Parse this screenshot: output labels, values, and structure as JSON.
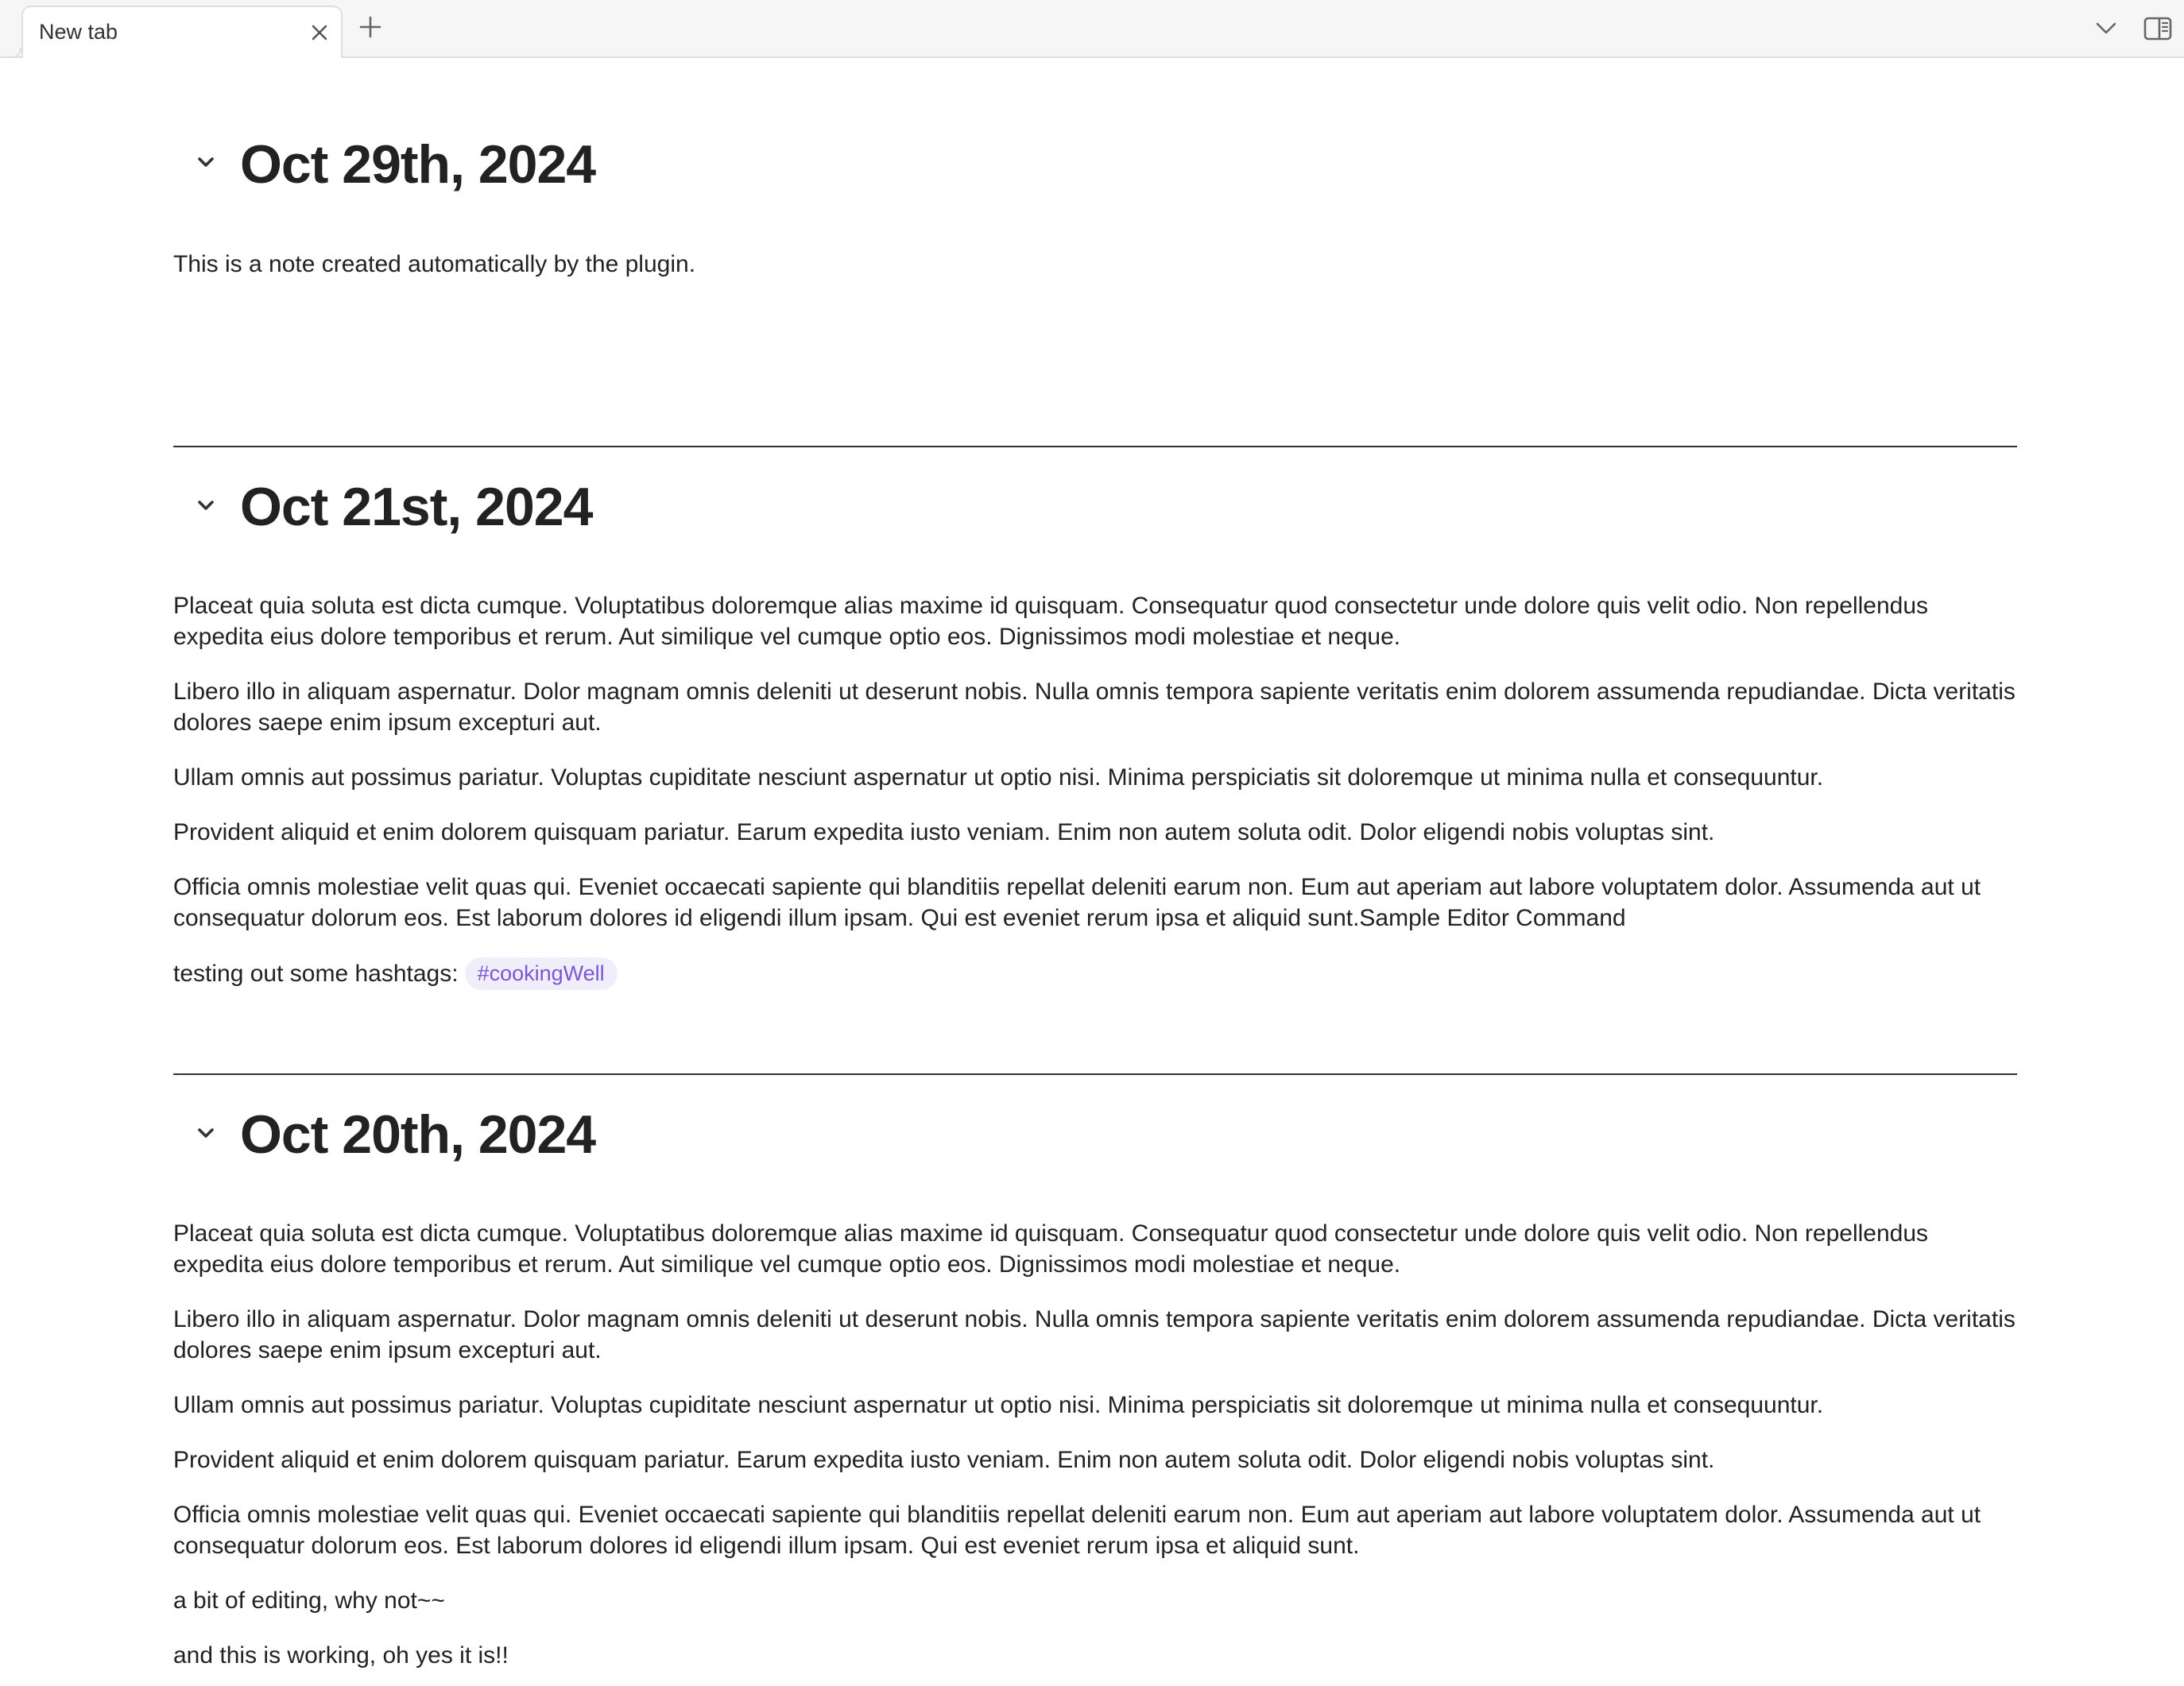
{
  "tabs": {
    "active_tab_title": "New tab",
    "close_icon": "close-icon",
    "new_tab_icon": "plus-icon",
    "tab_list_icon": "chevron-down-icon",
    "sidebar_icon": "sidebar-toggle-icon"
  },
  "colors": {
    "accent": "#7a55d6",
    "tag_background": "#f1eefc",
    "text": "#222222",
    "divider": "#333333"
  },
  "notes": [
    {
      "title": "Oct 29th, 2024",
      "paragraphs": [
        "This is a note created automatically by the plugin."
      ]
    },
    {
      "title": "Oct 21st, 2024",
      "paragraphs": [
        "Placeat quia soluta est dicta cumque. Voluptatibus doloremque alias maxime id quisquam. Consequatur quod consectetur unde dolore quis velit odio. Non repellendus expedita eius dolore temporibus et rerum. Aut similique vel cumque optio eos. Dignissimos modi molestiae et neque.",
        "Libero illo in aliquam aspernatur. Dolor magnam omnis deleniti ut deserunt nobis. Nulla omnis tempora sapiente veritatis enim dolorem assumenda repudiandae. Dicta veritatis dolores saepe enim ipsum excepturi aut.",
        "Ullam omnis aut possimus pariatur. Voluptas cupiditate nesciunt aspernatur ut optio nisi. Minima perspiciatis sit doloremque ut minima nulla et consequuntur.",
        "Provident aliquid et enim dolorem quisquam pariatur. Earum expedita iusto veniam. Enim non autem soluta odit. Dolor eligendi nobis voluptas sint.",
        "Officia omnis molestiae velit quas qui. Eveniet occaecati sapiente qui blanditiis repellat deleniti earum non. Eum aut aperiam aut labore voluptatem dolor. Assumenda aut ut consequatur dolorum eos. Est laborum dolores id eligendi illum ipsam. Qui est eveniet rerum ipsa et aliquid sunt.Sample Editor Command"
      ],
      "hashtag_line": "testing out some hashtags:",
      "hashtag": "#cookingWell"
    },
    {
      "title": "Oct 20th, 2024",
      "paragraphs": [
        "Placeat quia soluta est dicta cumque. Voluptatibus doloremque alias maxime id quisquam. Consequatur quod consectetur unde dolore quis velit odio. Non repellendus expedita eius dolore temporibus et rerum. Aut similique vel cumque optio eos. Dignissimos modi molestiae et neque.",
        "Libero illo in aliquam aspernatur. Dolor magnam omnis deleniti ut deserunt nobis. Nulla omnis tempora sapiente veritatis enim dolorem assumenda repudiandae. Dicta veritatis dolores saepe enim ipsum excepturi aut.",
        "Ullam omnis aut possimus pariatur. Voluptas cupiditate nesciunt aspernatur ut optio nisi. Minima perspiciatis sit doloremque ut minima nulla et consequuntur.",
        "Provident aliquid et enim dolorem quisquam pariatur. Earum expedita iusto veniam. Enim non autem soluta odit. Dolor eligendi nobis voluptas sint.",
        "Officia omnis molestiae velit quas qui. Eveniet occaecati sapiente qui blanditiis repellat deleniti earum non. Eum aut aperiam aut labore voluptatem dolor. Assumenda aut ut consequatur dolorum eos. Est laborum dolores id eligendi illum ipsam. Qui est eveniet rerum ipsa et aliquid sunt.",
        "a bit of editing, why not~~",
        "and this is working, oh yes it is!!"
      ]
    }
  ]
}
